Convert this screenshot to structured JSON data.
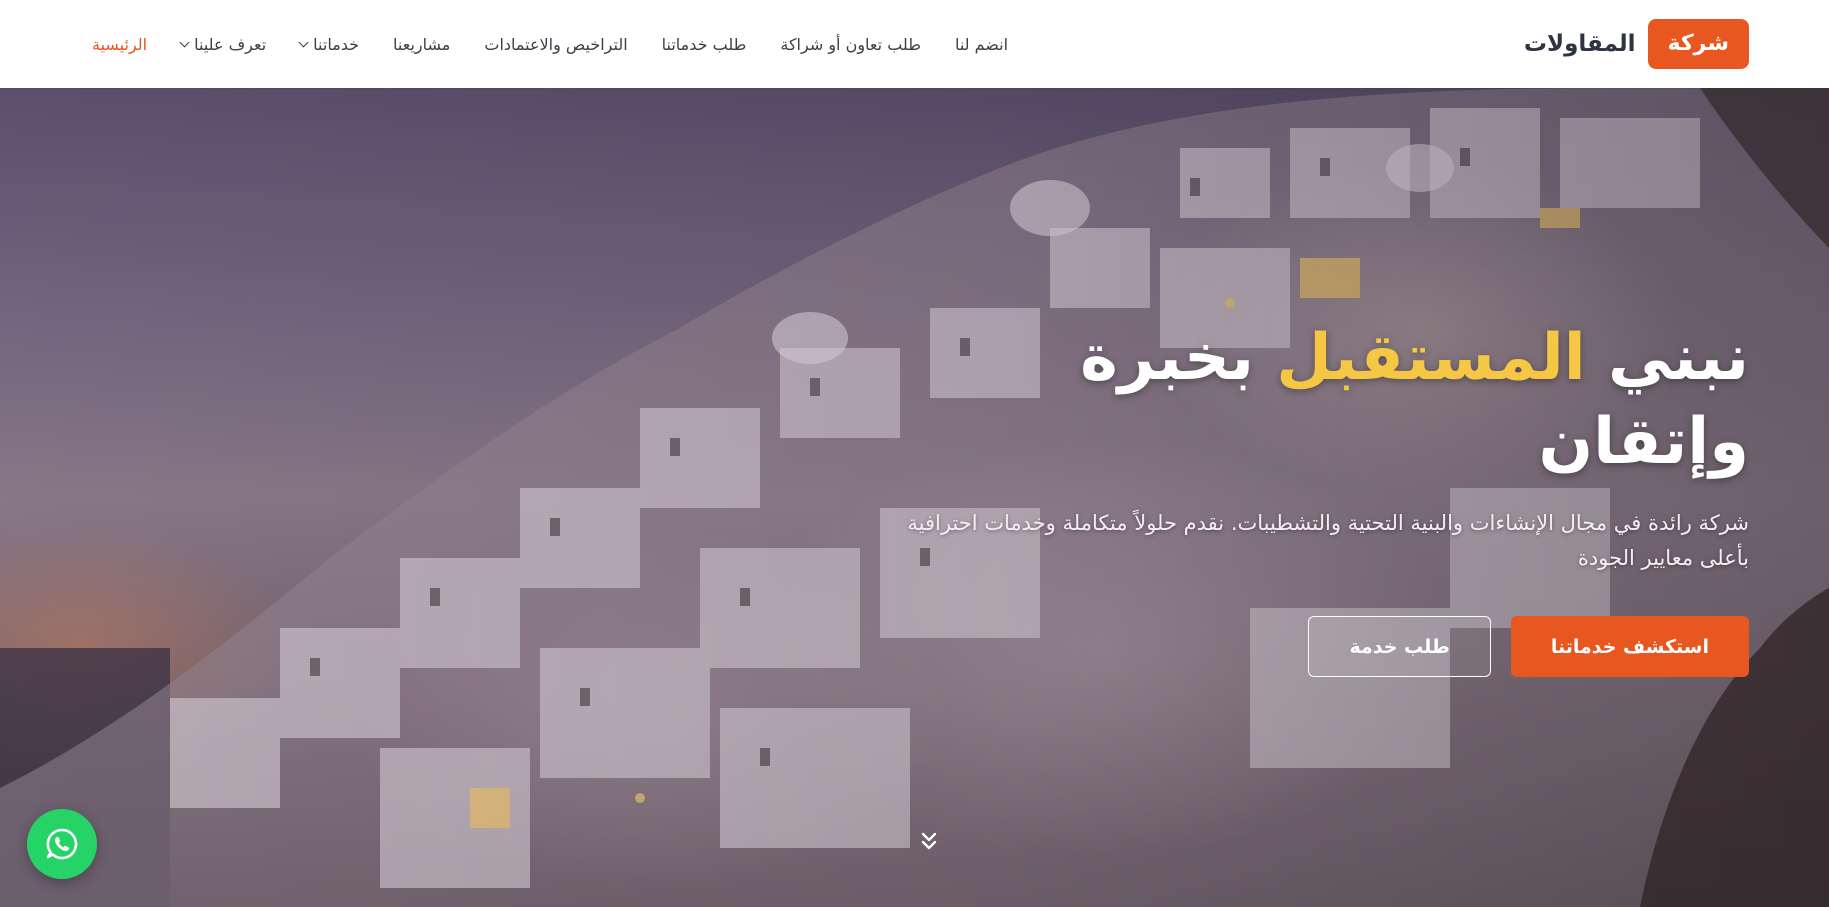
{
  "brand": {
    "badge": "شركة",
    "name": "المقاولات"
  },
  "nav": {
    "items": [
      {
        "label": "الرئيسية",
        "active": true
      },
      {
        "label": "تعرف علينا",
        "dropdown": true
      },
      {
        "label": "خدماتنا",
        "dropdown": true
      },
      {
        "label": "مشاريعنا"
      },
      {
        "label": "التراخيص والاعتمادات"
      },
      {
        "label": "طلب خدماتنا"
      },
      {
        "label": "طلب تعاون أو شراكة"
      },
      {
        "label": "انضم لنا"
      }
    ]
  },
  "hero": {
    "title_part1": "نبني",
    "title_accent": "المستقبل",
    "title_part2": "بخبرة",
    "title_line2": "وإتقان",
    "description": "شركة رائدة في مجال الإنشاءات والبنية التحتية والتشطيبات. نقدم حلولاً متكاملة وخدمات احترافية بأعلى معايير الجودة",
    "primary_button": "استكشف خدماتنا",
    "secondary_button": "طلب خدمة"
  },
  "icons": {
    "whatsapp": "whatsapp-icon",
    "scroll": "double-chevron-down-icon"
  },
  "colors": {
    "accent": "#e8571f",
    "highlight": "#f6c744",
    "whatsapp": "#25d366"
  }
}
